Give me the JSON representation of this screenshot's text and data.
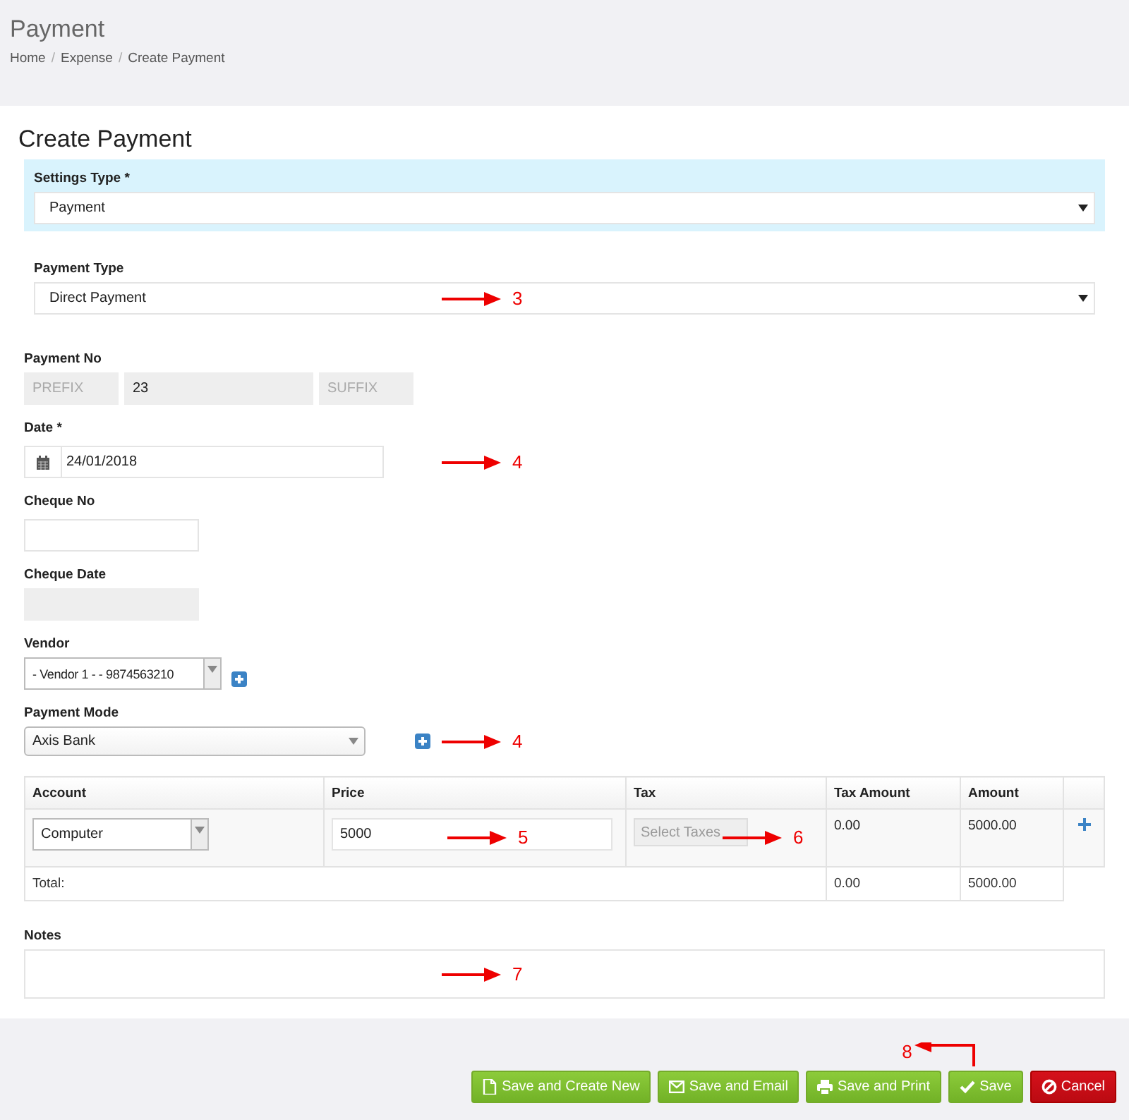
{
  "page_header": {
    "title": "Payment",
    "breadcrumb": [
      {
        "label": "Home",
        "separator": "/"
      },
      {
        "label": "Expense",
        "separator": "/"
      },
      {
        "label": "Create Payment"
      }
    ]
  },
  "form": {
    "title": "Create Payment",
    "settings_type": {
      "label": "Settings Type *",
      "value": "Payment"
    },
    "payment_type": {
      "label": "Payment Type",
      "value": "Direct Payment",
      "callout": "3"
    },
    "payment_no": {
      "label": "Payment No",
      "parts": [
        {
          "kind": "prefix",
          "placeholder": "PREFIX",
          "disabled": true
        },
        {
          "kind": "number",
          "value": "23",
          "disabled": true
        },
        {
          "kind": "suffix",
          "placeholder": "SUFFIX",
          "disabled": true
        }
      ]
    },
    "date": {
      "label": "Date *",
      "value": "24/01/2018",
      "callout": "4"
    },
    "cheque_no": {
      "label": "Cheque No",
      "disabled": false
    },
    "cheque_date": {
      "label": "Cheque Date",
      "disabled": true
    },
    "vendor": {
      "label": "Vendor",
      "value": "- Vendor 1 - - 9874563210"
    },
    "payment_mode": {
      "label": "Payment Mode",
      "value": "Axis Bank",
      "callout": "4"
    },
    "table": {
      "columns": [
        "Account",
        "Price",
        "Tax",
        "Tax Amount",
        "Amount"
      ],
      "rows": [
        {
          "account": "Computer",
          "price": "5000",
          "price_callout": "5",
          "tax_placeholder": "Select Taxes",
          "tax_disabled": true,
          "tax_callout": "6",
          "tax_amount": "0.00",
          "amount": "5000.00"
        }
      ],
      "total": {
        "label": "Total:",
        "tax_amount": "0.00",
        "amount": "5000.00"
      }
    },
    "notes": {
      "label": "Notes",
      "callout": "7"
    }
  },
  "buttons": [
    {
      "label": "Save and Create New",
      "kind": "success"
    },
    {
      "label": "Save and Email",
      "kind": "success"
    },
    {
      "label": "Save and Print",
      "kind": "success"
    },
    {
      "label": "Save",
      "kind": "success",
      "callout": "8"
    },
    {
      "label": "Cancel",
      "kind": "danger"
    }
  ]
}
